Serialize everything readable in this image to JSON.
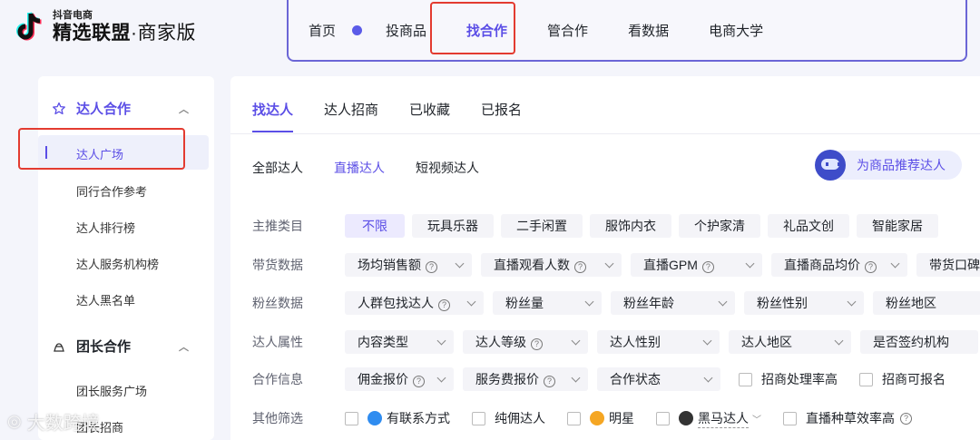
{
  "header": {
    "logo_small": "抖音电商",
    "logo_big_main": "精选联盟",
    "logo_big_sub": "·商家版",
    "nav": [
      {
        "label": "首页"
      },
      {
        "label": "投商品"
      },
      {
        "label": "找合作",
        "active": true
      },
      {
        "label": "管合作"
      },
      {
        "label": "看数据"
      },
      {
        "label": "电商大学"
      }
    ]
  },
  "sidebar": {
    "group1": {
      "label": "达人合作",
      "icon": "star-icon"
    },
    "items1": [
      "达人广场",
      "同行合作参考",
      "达人排行榜",
      "达人服务机构榜",
      "达人黑名单"
    ],
    "group2": {
      "label": "团长合作",
      "icon": "team-leader-icon"
    },
    "items2": [
      "团长服务广场",
      "团长招商"
    ]
  },
  "main": {
    "tabs": [
      "找达人",
      "达人招商",
      "已收藏",
      "已报名"
    ],
    "subtabs": [
      "全部达人",
      "直播达人",
      "短视频达人"
    ],
    "recommend_label": "为商品推荐达人",
    "filters": {
      "category": {
        "label": "主推类目",
        "chips": [
          "不限",
          "玩具乐器",
          "二手闲置",
          "服饰内衣",
          "个护家清",
          "礼品文创",
          "智能家居"
        ]
      },
      "sales": {
        "label": "带货数据",
        "dropdowns": [
          "场均销售额",
          "直播观看人数",
          "直播GPM",
          "直播商品均价",
          "带货口碑"
        ]
      },
      "fans": {
        "label": "粉丝数据",
        "dropdowns": [
          "人群包找达人",
          "粉丝量",
          "粉丝年龄",
          "粉丝性别",
          "粉丝地区"
        ]
      },
      "attr": {
        "label": "达人属性",
        "dropdowns": [
          "内容类型",
          "达人等级",
          "达人性别",
          "达人地区",
          "是否签约机构"
        ]
      },
      "coop": {
        "label": "合作信息",
        "dropdowns": [
          "佣金报价",
          "服务费报价",
          "合作状态"
        ],
        "checkboxes": [
          "招商处理率高",
          "招商可报名"
        ]
      },
      "other": {
        "label": "其他筛选",
        "checkboxes": [
          "有联系方式",
          "纯佣达人",
          "明星",
          "黑马达人",
          "直播种草效率高"
        ]
      }
    }
  },
  "watermark": "大数跨境",
  "colors": {
    "accent": "#5b4ee6",
    "highlight": "#e33b30"
  }
}
